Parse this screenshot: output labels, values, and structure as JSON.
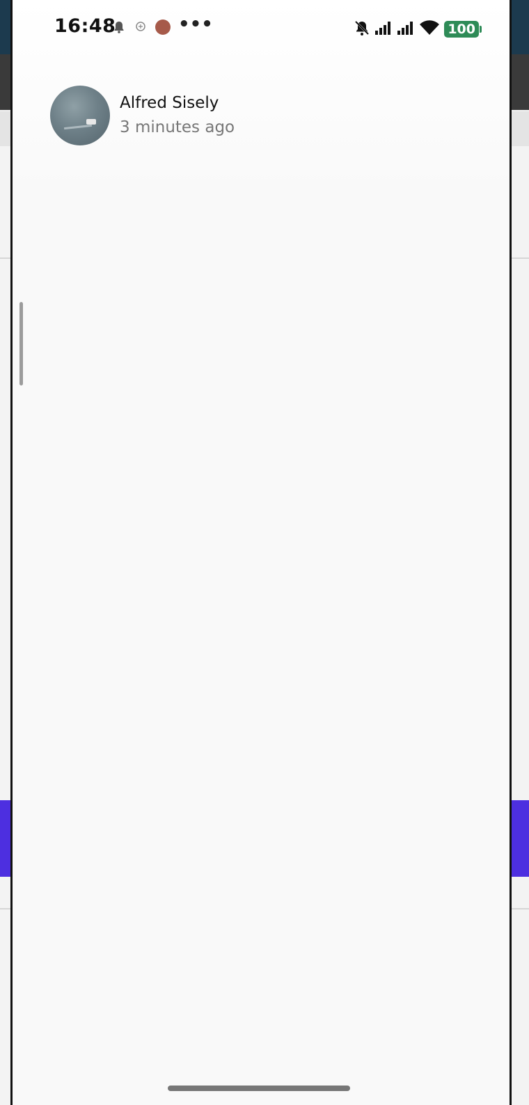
{
  "status_bar": {
    "time": "16:48",
    "battery": "100",
    "icons": [
      "notification-bell-icon",
      "circle-icon",
      "app-icon",
      "more-dots-icon",
      "silent-bell-icon",
      "signal-icon",
      "signal-icon",
      "wifi-icon",
      "battery-icon"
    ]
  },
  "post": {
    "author": "Alfred Sisely",
    "time_ago": "3 minutes ago"
  },
  "colors": {
    "battery": "#2e8b57",
    "background": "#f9f9f9"
  }
}
